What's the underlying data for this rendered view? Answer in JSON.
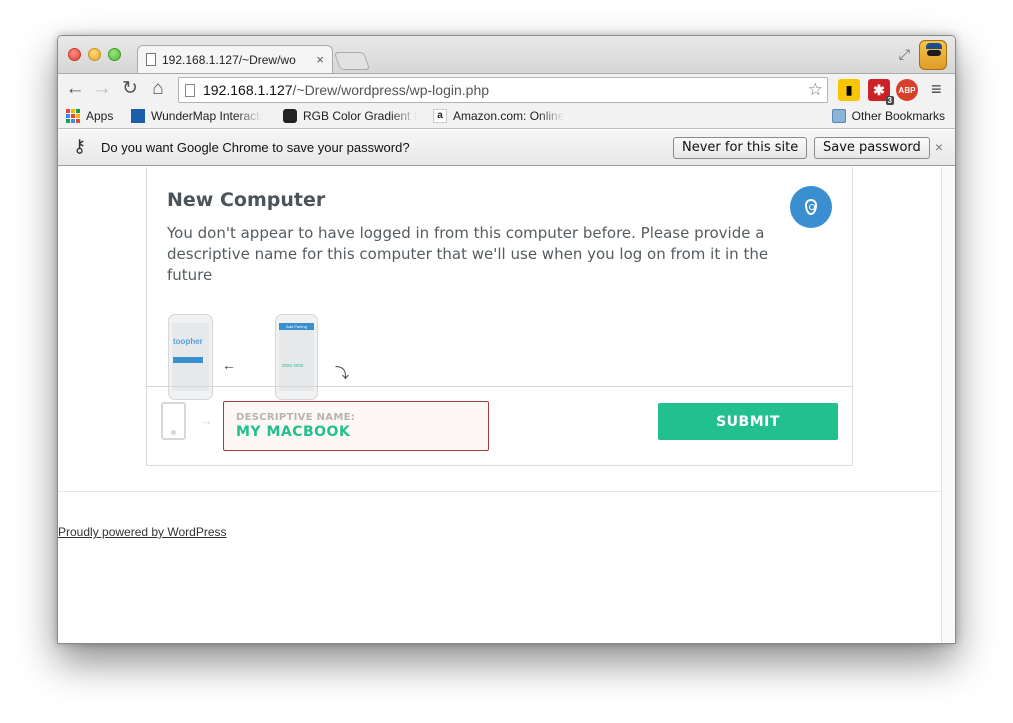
{
  "browser": {
    "tab_title": "192.168.1.127/~Drew/wo",
    "tab_close": "×",
    "url_host": "192.168.1.127",
    "url_path": "/~Drew/wordpress/wp-login.php",
    "bookmark_star": "☆",
    "extensions": {
      "lastpass_badge": "3",
      "abp_label": "ABP"
    }
  },
  "bookmarks": {
    "apps": "Apps",
    "items": [
      "WunderMap Interacti",
      "RGB Color Gradient I",
      "Amazon.com: Online"
    ],
    "other": "Other Bookmarks"
  },
  "infobar": {
    "message": "Do you want Google Chrome to save your password?",
    "never_button": "Never for this site",
    "save_button": "Save password",
    "close": "×"
  },
  "card": {
    "title": "New Computer",
    "description": "You don't appear to have logged in from this computer before. Please provide a descriptive name for this computer that we'll use when you log on from it in the future",
    "phone1_logo": "toopher",
    "phone2_header": "Add Pairing",
    "phone2_code": "xxxx xxxx",
    "field_label": "DESCRIPTIVE NAME:",
    "field_value": "MY MACBOOK",
    "submit_label": "SUBMIT"
  },
  "footer": {
    "powered_by": "Proudly powered by WordPress"
  },
  "colors": {
    "accent_green": "#23c08f",
    "accent_blue": "#3a8fd1",
    "field_border": "#a33c3c"
  }
}
